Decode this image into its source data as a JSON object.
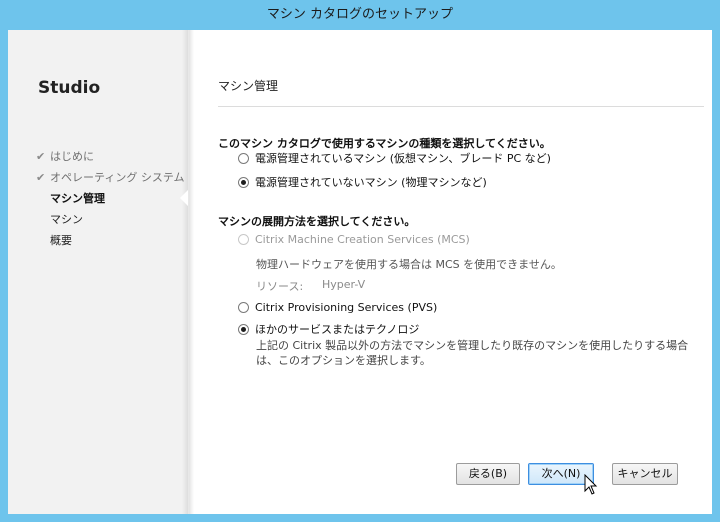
{
  "window": {
    "title": "マシン カタログのセットアップ"
  },
  "sidebar": {
    "brand": "Studio",
    "steps": [
      {
        "label": "はじめに",
        "state": "done"
      },
      {
        "label": "オペレーティング システム",
        "state": "done"
      },
      {
        "label": "マシン管理",
        "state": "current"
      },
      {
        "label": "マシン",
        "state": "todo"
      },
      {
        "label": "概要",
        "state": "todo"
      }
    ],
    "check_glyph": "✔"
  },
  "main": {
    "title": "マシン管理",
    "q1": {
      "label": "このマシン カタログで使用するマシンの種類を選択してください。",
      "options": [
        {
          "label": "電源管理されているマシン (仮想マシン、ブレード PC など)",
          "checked": false
        },
        {
          "label": "電源管理されていないマシン (物理マシンなど)",
          "checked": true
        }
      ]
    },
    "q2": {
      "label": "マシンの展開方法を選択してください。",
      "mcs": {
        "label": "Citrix Machine Creation Services (MCS)",
        "checked": false,
        "disabled": true,
        "note": "物理ハードウェアを使用する場合は MCS を使用できません。",
        "resource_label": "リソース:",
        "resource_value": "Hyper-V"
      },
      "pvs": {
        "label": "Citrix Provisioning Services (PVS)",
        "checked": false
      },
      "other": {
        "label": "ほかのサービスまたはテクノロジ",
        "checked": true,
        "description": "上記の Citrix 製品以外の方法でマシンを管理したり既存のマシンを使用したりする場合は、このオプションを選択します。"
      }
    }
  },
  "buttons": {
    "back": "戻る(B)",
    "next": "次へ(N)",
    "cancel": "キャンセル"
  },
  "colors": {
    "title_bar": "#6ec4ec",
    "sidebar_bg": "#f2f2f2",
    "primary_border": "#3d8ee0"
  }
}
